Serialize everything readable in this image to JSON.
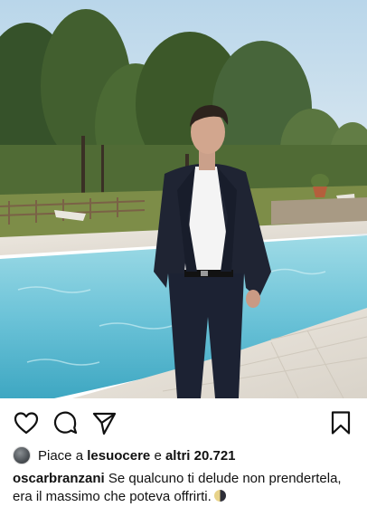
{
  "post": {
    "liked_by_prefix": "Piace a",
    "liked_by_user": "lesuocere",
    "liked_by_joiner": "e",
    "likes_count": "altri 20.721",
    "caption_user": "oscarbranzani",
    "caption_text": "Se qualcuno ti delude non prendertela, era il massimo che poteva offrirti."
  },
  "icons": {
    "like": "heart-outline-icon",
    "comment": "speech-bubble-icon",
    "share": "paper-plane-icon",
    "save": "bookmark-icon",
    "caption_emoji": "half-moon-emoji"
  },
  "colors": {
    "text": "#111111",
    "pool_water": "#7fd0e0",
    "sky": "#cfe2ee"
  }
}
